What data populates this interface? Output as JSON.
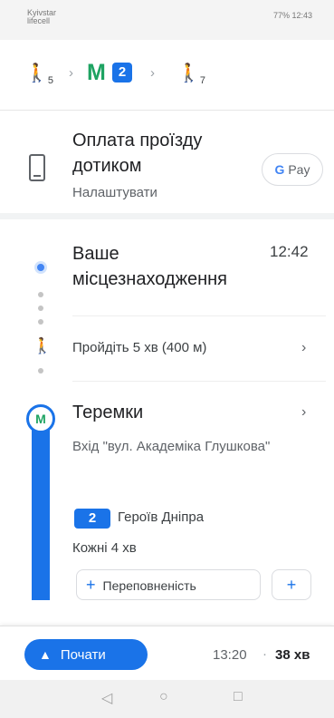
{
  "status_bar": {
    "carrier": "Kyivstar",
    "carrier2": "lifecell",
    "battery": "77%",
    "time": "12:43"
  },
  "summary": {
    "walk_start_minutes": "5",
    "line_number": "2",
    "walk_end_minutes": "7"
  },
  "payment": {
    "title": "Оплата проїзду дотиком",
    "subtitle": "Налаштувати",
    "gpay_g": "G",
    "gpay_label": "Pay"
  },
  "location": {
    "title": "Ваше місцезнаходження",
    "time": "12:42"
  },
  "walk": {
    "label": "Пройдіть 5 хв (400 м)"
  },
  "stop": {
    "metro_symbol": "M",
    "name": "Теремки",
    "entrance": "Вхід \"вул. Академіка Глушкова\"",
    "line_number": "2",
    "direction": "Героїв Дніпра",
    "frequency": "Кожні 4 хв",
    "crowd_label": "Переповненість"
  },
  "bottom_bar": {
    "start_label": "Почати",
    "arrival_time": "13:20",
    "separator": "·",
    "duration": "38 хв"
  },
  "colors": {
    "accent": "#1a73e8",
    "metro_green": "#1ea362"
  }
}
